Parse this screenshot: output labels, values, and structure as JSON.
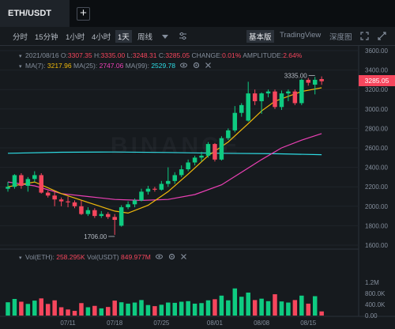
{
  "pair": "ETH/USDT",
  "add_tab": "+",
  "toolbar": {
    "intervals": [
      "分时",
      "15分钟",
      "1小时",
      "4小时",
      "1天",
      "周线"
    ],
    "selected_interval": "1天",
    "view_modes": [
      "基本版",
      "TradingView",
      "深度图"
    ],
    "selected_view": "基本版"
  },
  "legend": {
    "date": "2021/08/16",
    "o_label": "O:",
    "o": "3307.35",
    "h_label": "H:",
    "h": "3335.00",
    "l_label": "L:",
    "l": "3248.31",
    "c_label": "C:",
    "c": "3285.05",
    "change_label": "CHANGE:",
    "change": "0.01%",
    "amp_label": "AMPLITUDE:",
    "amp": "2.64%",
    "ma7_label": "MA(7):",
    "ma7": "3217.96",
    "ma25_label": "MA(25):",
    "ma25": "2747.06",
    "ma99_label": "MA(99):",
    "ma99": "2529.78",
    "vol_eth_label": "Vol(ETH):",
    "vol_eth": "258.295K",
    "vol_usdt_label": "Vol(USDT)",
    "vol_usdt": "849.977M"
  },
  "last_price": "3285.05",
  "watermark": "BINANCE",
  "colors": {
    "up": "#0ecb81",
    "down": "#f6465d",
    "ma7": "#f0b90b",
    "ma25": "#eb40b5",
    "ma99": "#2edce4"
  },
  "chart_data": {
    "type": "candlestick",
    "price_axis": {
      "ylim": [
        1600,
        3400
      ],
      "ticks": [
        1600,
        1800,
        2000,
        2200,
        2400,
        2600,
        2800,
        3000,
        3200,
        3400
      ],
      "extra_tick": 3600,
      "tick_labels": [
        "1600.00",
        "1800.00",
        "2000.00",
        "2200.00",
        "2400.00",
        "2600.00",
        "2800.00",
        "3000.00",
        "3200.00",
        "3400.00",
        "3600.00"
      ]
    },
    "volume_axis": {
      "ylim": [
        0,
        1200000
      ],
      "ticks": [
        0,
        400000,
        800000,
        1200000
      ],
      "tick_labels": [
        "0.00",
        "400.0K",
        "800.0K",
        "1.2M"
      ]
    },
    "x_tick_labels": [
      {
        "label": "07/11",
        "index": 9
      },
      {
        "label": "07/18",
        "index": 16
      },
      {
        "label": "07/25",
        "index": 23
      },
      {
        "label": "08/01",
        "index": 31
      },
      {
        "label": "08/08",
        "index": 38
      },
      {
        "label": "08/15",
        "index": 45
      }
    ],
    "annotations": [
      {
        "text": "3335.00",
        "index": 46,
        "price": 3335
      },
      {
        "text": "1706.00",
        "index": 16,
        "price": 1706
      }
    ],
    "candles": [
      {
        "o": 2180,
        "h": 2250,
        "l": 2150,
        "c": 2200
      },
      {
        "o": 2200,
        "h": 2330,
        "l": 2180,
        "c": 2320
      },
      {
        "o": 2320,
        "h": 2340,
        "l": 2180,
        "c": 2210
      },
      {
        "o": 2210,
        "h": 2300,
        "l": 2150,
        "c": 2280
      },
      {
        "o": 2280,
        "h": 2360,
        "l": 2250,
        "c": 2320
      },
      {
        "o": 2320,
        "h": 2340,
        "l": 2130,
        "c": 2140
      },
      {
        "o": 2140,
        "h": 2160,
        "l": 2090,
        "c": 2110
      },
      {
        "o": 2110,
        "h": 2150,
        "l": 2000,
        "c": 2070
      },
      {
        "o": 2070,
        "h": 2090,
        "l": 2000,
        "c": 2050
      },
      {
        "o": 2050,
        "h": 2100,
        "l": 1990,
        "c": 2040
      },
      {
        "o": 2040,
        "h": 2060,
        "l": 1980,
        "c": 2000
      },
      {
        "o": 2000,
        "h": 2060,
        "l": 1910,
        "c": 1920
      },
      {
        "o": 1920,
        "h": 1990,
        "l": 1900,
        "c": 1960
      },
      {
        "o": 1960,
        "h": 1980,
        "l": 1880,
        "c": 1900
      },
      {
        "o": 1900,
        "h": 1950,
        "l": 1880,
        "c": 1920
      },
      {
        "o": 1920,
        "h": 1940,
        "l": 1870,
        "c": 1890
      },
      {
        "o": 1890,
        "h": 1920,
        "l": 1706,
        "c": 1860
      },
      {
        "o": 1800,
        "h": 2010,
        "l": 1790,
        "c": 1990
      },
      {
        "o": 1990,
        "h": 2050,
        "l": 1970,
        "c": 2020
      },
      {
        "o": 2020,
        "h": 2080,
        "l": 1990,
        "c": 2060
      },
      {
        "o": 2060,
        "h": 2180,
        "l": 2050,
        "c": 2150
      },
      {
        "o": 2150,
        "h": 2210,
        "l": 2120,
        "c": 2180
      },
      {
        "o": 2180,
        "h": 2200,
        "l": 2150,
        "c": 2170
      },
      {
        "o": 2170,
        "h": 2260,
        "l": 2160,
        "c": 2230
      },
      {
        "o": 2230,
        "h": 2400,
        "l": 2200,
        "c": 2260
      },
      {
        "o": 2260,
        "h": 2350,
        "l": 2230,
        "c": 2320
      },
      {
        "o": 2320,
        "h": 2420,
        "l": 2300,
        "c": 2380
      },
      {
        "o": 2380,
        "h": 2480,
        "l": 2360,
        "c": 2450
      },
      {
        "o": 2450,
        "h": 2520,
        "l": 2420,
        "c": 2500
      },
      {
        "o": 2500,
        "h": 2560,
        "l": 2460,
        "c": 2520
      },
      {
        "o": 2520,
        "h": 2660,
        "l": 2500,
        "c": 2640
      },
      {
        "o": 2640,
        "h": 2650,
        "l": 2460,
        "c": 2480
      },
      {
        "o": 2480,
        "h": 2720,
        "l": 2470,
        "c": 2700
      },
      {
        "o": 2700,
        "h": 2800,
        "l": 2680,
        "c": 2780
      },
      {
        "o": 2780,
        "h": 3030,
        "l": 2760,
        "c": 2960
      },
      {
        "o": 2960,
        "h": 3060,
        "l": 2920,
        "c": 3040
      },
      {
        "o": 2880,
        "h": 3280,
        "l": 2870,
        "c": 3160
      },
      {
        "o": 3160,
        "h": 3200,
        "l": 3040,
        "c": 3080
      },
      {
        "o": 3080,
        "h": 3170,
        "l": 2950,
        "c": 3160
      },
      {
        "o": 3160,
        "h": 3200,
        "l": 3120,
        "c": 3180
      },
      {
        "o": 3180,
        "h": 3200,
        "l": 3000,
        "c": 3020
      },
      {
        "o": 3020,
        "h": 3190,
        "l": 2990,
        "c": 3160
      },
      {
        "o": 3160,
        "h": 3200,
        "l": 3080,
        "c": 3180
      },
      {
        "o": 3180,
        "h": 3200,
        "l": 3040,
        "c": 3060
      },
      {
        "o": 3060,
        "h": 3310,
        "l": 3040,
        "c": 3300
      },
      {
        "o": 3300,
        "h": 3320,
        "l": 3240,
        "c": 3270
      },
      {
        "o": 3250,
        "h": 3330,
        "l": 3150,
        "c": 3300
      },
      {
        "o": 3307.35,
        "h": 3335,
        "l": 3248.31,
        "c": 3285.05
      }
    ],
    "volumes": [
      {
        "v": 480000,
        "up": true
      },
      {
        "v": 600000,
        "up": true
      },
      {
        "v": 500000,
        "up": false
      },
      {
        "v": 420000,
        "up": true
      },
      {
        "v": 540000,
        "up": true
      },
      {
        "v": 620000,
        "up": false
      },
      {
        "v": 420000,
        "up": false
      },
      {
        "v": 550000,
        "up": false
      },
      {
        "v": 300000,
        "up": false
      },
      {
        "v": 220000,
        "up": false
      },
      {
        "v": 170000,
        "up": false
      },
      {
        "v": 450000,
        "up": false
      },
      {
        "v": 300000,
        "up": true
      },
      {
        "v": 350000,
        "up": false
      },
      {
        "v": 260000,
        "up": true
      },
      {
        "v": 310000,
        "up": false
      },
      {
        "v": 540000,
        "up": false
      },
      {
        "v": 480000,
        "up": true
      },
      {
        "v": 430000,
        "up": true
      },
      {
        "v": 470000,
        "up": true
      },
      {
        "v": 560000,
        "up": true
      },
      {
        "v": 380000,
        "up": true
      },
      {
        "v": 340000,
        "up": false
      },
      {
        "v": 390000,
        "up": true
      },
      {
        "v": 470000,
        "up": true
      },
      {
        "v": 460000,
        "up": true
      },
      {
        "v": 500000,
        "up": true
      },
      {
        "v": 520000,
        "up": true
      },
      {
        "v": 430000,
        "up": true
      },
      {
        "v": 450000,
        "up": true
      },
      {
        "v": 550000,
        "up": true
      },
      {
        "v": 590000,
        "up": false
      },
      {
        "v": 720000,
        "up": true
      },
      {
        "v": 550000,
        "up": true
      },
      {
        "v": 980000,
        "up": true
      },
      {
        "v": 680000,
        "up": true
      },
      {
        "v": 830000,
        "up": true
      },
      {
        "v": 560000,
        "up": false
      },
      {
        "v": 610000,
        "up": true
      },
      {
        "v": 520000,
        "up": true
      },
      {
        "v": 770000,
        "up": false
      },
      {
        "v": 510000,
        "up": true
      },
      {
        "v": 470000,
        "up": true
      },
      {
        "v": 560000,
        "up": false
      },
      {
        "v": 720000,
        "up": true
      },
      {
        "v": 430000,
        "up": false
      },
      {
        "v": 700000,
        "up": true
      },
      {
        "v": 150000,
        "up": false
      }
    ],
    "ma7_points": [
      [
        0,
        2200
      ],
      [
        4,
        2250
      ],
      [
        8,
        2130
      ],
      [
        12,
        2040
      ],
      [
        16,
        1950
      ],
      [
        18,
        1930
      ],
      [
        21,
        2010
      ],
      [
        24,
        2150
      ],
      [
        27,
        2330
      ],
      [
        30,
        2520
      ],
      [
        33,
        2660
      ],
      [
        36,
        2850
      ],
      [
        38,
        2980
      ],
      [
        40,
        3080
      ],
      [
        42,
        3130
      ],
      [
        44,
        3180
      ],
      [
        47,
        3218
      ]
    ],
    "ma25_points": [
      [
        0,
        2250
      ],
      [
        4,
        2210
      ],
      [
        8,
        2130
      ],
      [
        12,
        2100
      ],
      [
        16,
        2070
      ],
      [
        20,
        2060
      ],
      [
        24,
        2070
      ],
      [
        28,
        2120
      ],
      [
        32,
        2220
      ],
      [
        35,
        2350
      ],
      [
        38,
        2480
      ],
      [
        41,
        2600
      ],
      [
        44,
        2680
      ],
      [
        47,
        2747
      ]
    ],
    "ma99_points": [
      [
        0,
        2545
      ],
      [
        8,
        2555
      ],
      [
        16,
        2558
      ],
      [
        24,
        2553
      ],
      [
        32,
        2545
      ],
      [
        40,
        2540
      ],
      [
        47,
        2530
      ]
    ]
  }
}
